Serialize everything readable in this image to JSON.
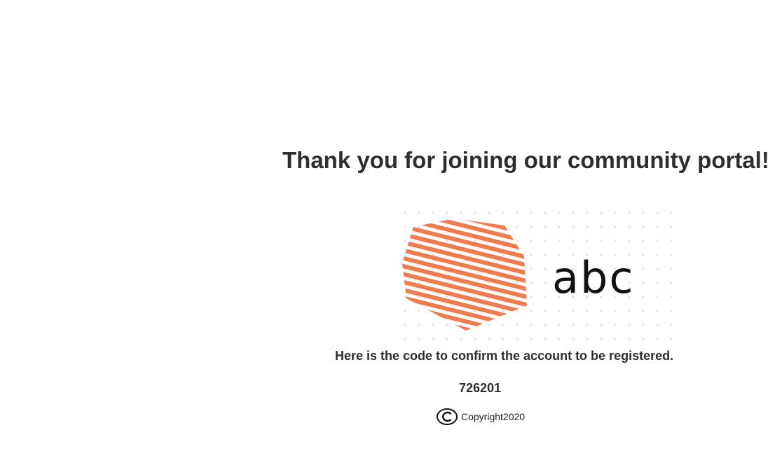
{
  "heading": "Thank you for joining our community portal!",
  "logo": {
    "text": "abc",
    "colors": {
      "stripe": "#f07b4e",
      "text": "#111111",
      "dots": "#d4d4d4"
    }
  },
  "confirm_message": "Here is the code to confirm the account to be registered.",
  "code": "726201",
  "footer": {
    "copyright_text": "Copyright2020",
    "icon": "copyright-icon"
  }
}
